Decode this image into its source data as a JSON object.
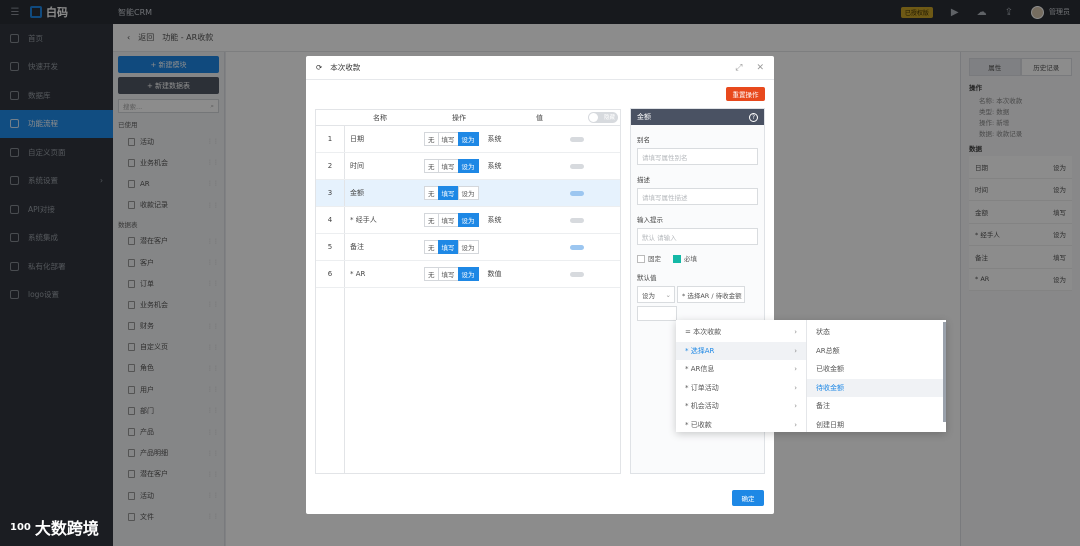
{
  "topbar": {
    "logo": "白码",
    "app_name": "智能CRM",
    "license_badge": "已授权版",
    "user": "管理员"
  },
  "nav": {
    "items": [
      {
        "label": "首页"
      },
      {
        "label": "快速开发"
      },
      {
        "label": "数据库"
      },
      {
        "label": "功能流程",
        "active": true
      },
      {
        "label": "自定义页面"
      },
      {
        "label": "系统设置"
      },
      {
        "label": "API对接"
      },
      {
        "label": "系统集成"
      },
      {
        "label": "私有化部署"
      },
      {
        "label": "logo设置"
      }
    ]
  },
  "breadcrumb": {
    "back": "返回",
    "path": "功能 - AR收款"
  },
  "mid": {
    "new_module": "+ 新建模块",
    "new_table": "+ 新建数据表",
    "search_placeholder": "搜索...",
    "section_used": "已使用",
    "used_items": [
      "活动",
      "业务机会",
      "AR",
      "收款记录"
    ],
    "section_tables": "数据表",
    "table_items": [
      "潜在客户",
      "客户",
      "订单",
      "业务机会",
      "财务",
      "自定义页",
      "角色",
      "用户",
      "部门",
      "产品",
      "产品明细",
      "潜在客户",
      "活动",
      "文件"
    ]
  },
  "right": {
    "tab_props": "属性",
    "tab_history": "历史记录",
    "op_title": "操作",
    "op_kv": [
      "名称: 本次收款",
      "类型: 数据",
      "操作: 新增",
      "数据: 收款记录"
    ],
    "data_title": "数据",
    "data_rows": [
      [
        "日期",
        "设为"
      ],
      [
        "时间",
        "设为"
      ],
      [
        "金额",
        "填写"
      ],
      [
        "* 经手人",
        "设为"
      ],
      [
        "备注",
        "填写"
      ],
      [
        "* AR",
        "设为"
      ]
    ]
  },
  "modal": {
    "title": "本次收款",
    "reset_label": "重置操作",
    "ok_label": "确定",
    "grid_headers": {
      "name": "名称",
      "op": "操作",
      "value": "值",
      "toggle": "隐藏"
    },
    "op_labels": {
      "none": "无",
      "fill": "填写",
      "set": "设为"
    },
    "rows": [
      {
        "num": "1",
        "name": "日期",
        "active": "set",
        "value": "系统",
        "switch_on": false,
        "selected": false
      },
      {
        "num": "2",
        "name": "时间",
        "active": "set",
        "value": "系统",
        "switch_on": false,
        "selected": false
      },
      {
        "num": "3",
        "name": "金额",
        "active": "fill",
        "value": "",
        "switch_on": true,
        "selected": true
      },
      {
        "num": "4",
        "name": "* 经手人",
        "active": "set",
        "value": "系统",
        "switch_on": false,
        "selected": false
      },
      {
        "num": "5",
        "name": "备注",
        "active": "fill",
        "value": "",
        "switch_on": true,
        "selected": false
      },
      {
        "num": "6",
        "name": "* AR",
        "active": "set",
        "value": "数值",
        "switch_on": false,
        "selected": false
      }
    ],
    "prop": {
      "title": "金额",
      "alias_label": "别名",
      "alias_placeholder": "请填写属性别名",
      "desc_label": "描述",
      "desc_placeholder": "请填写属性描述",
      "hint_label": "输入提示",
      "hint_placeholder": "默认 请输入",
      "fixed_label": "固定",
      "required_label": "必填",
      "default_label": "默认值",
      "default_mode": "设为",
      "default_value": "* 选择AR / 待收金额"
    }
  },
  "cascade": {
    "col_a": [
      {
        "label": "= 本次收款",
        "on": false
      },
      {
        "label": "* 选择AR",
        "on": true
      },
      {
        "label": "* AR信息",
        "on": false
      },
      {
        "label": "* 订单活动",
        "on": false
      },
      {
        "label": "* 机会活动",
        "on": false
      },
      {
        "label": "* 已收款",
        "on": false
      }
    ],
    "col_b": [
      {
        "label": "状态",
        "on": false
      },
      {
        "label": "AR总额",
        "on": false
      },
      {
        "label": "已收金额",
        "on": false
      },
      {
        "label": "待收金额",
        "on": true
      },
      {
        "label": "备注",
        "on": false
      },
      {
        "label": "创建日期",
        "on": false
      }
    ]
  },
  "watermark": {
    "text": "大数跨境",
    "logo": "100"
  },
  "colors": {
    "primary": "#1e88e5",
    "danger": "#e8491d",
    "nav_bg": "#32363f",
    "topbar_bg": "#2b2f36"
  }
}
